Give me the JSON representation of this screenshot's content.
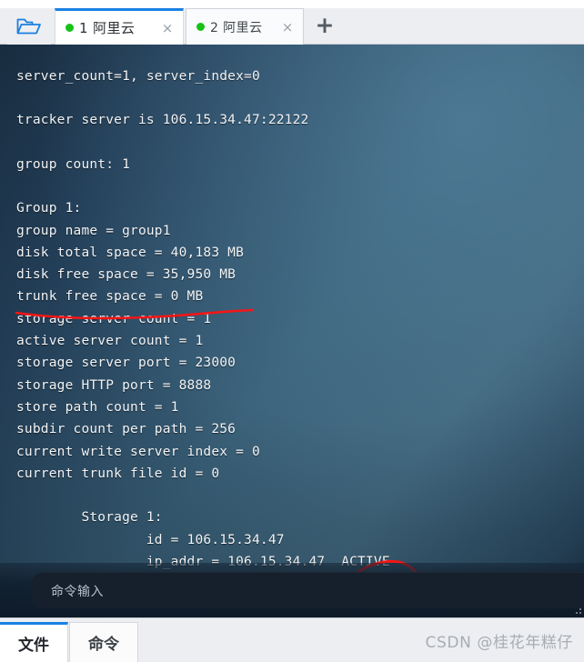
{
  "window": {
    "folder_icon": "open-folder-icon",
    "new_tab_label": "+"
  },
  "tabs": [
    {
      "index": "1",
      "label": "1 阿里云",
      "status_color": "#16c216",
      "close_label": "×",
      "active": true
    },
    {
      "index": "2",
      "label": "2 阿里云",
      "status_color": "#16c216",
      "close_label": "×",
      "active": false
    }
  ],
  "terminal": {
    "background_color": "#3a6179",
    "text_color": "#f2f4f6",
    "output": "server_count=1, server_index=0\n\ntracker server is 106.15.34.47:22122\n\ngroup count: 1\n\nGroup 1:\ngroup name = group1\ndisk total space = 40,183 MB\ndisk free space = 35,950 MB\ntrunk free space = 0 MB\nstorage server count = 1\nactive server count = 1\nstorage server port = 23000\nstorage HTTP port = 8888\nstore path count = 1\nsubdir count per path = 256\ncurrent write server index = 0\ncurrent trunk file id = 0\n\n        Storage 1:\n                id = 106.15.34.47\n                ip_addr = 106.15.34.47  ACTIVE",
    "lines": [
      "server_count=1, server_index=0",
      "",
      "tracker server is 106.15.34.47:22122",
      "",
      "group count: 1",
      "",
      "Group 1:",
      "group name = group1",
      "disk total space = 40,183 MB",
      "disk free space = 35,950 MB",
      "trunk free space = 0 MB",
      "storage server count = 1",
      "active server count = 1",
      "storage server port = 23000",
      "storage HTTP port = 8888",
      "store path count = 1",
      "subdir count per path = 256",
      "current write server index = 0",
      "current trunk file id = 0",
      "",
      "        Storage 1:",
      "                id = 106.15.34.47",
      "                ip_addr = 106.15.34.47  ACTIVE"
    ]
  },
  "annotations": {
    "color": "#f31616",
    "underline_target": "disk free space = 35,950 MB",
    "circle_target": "ACTIVE"
  },
  "command_input": {
    "placeholder": "命令输入",
    "value": ""
  },
  "bottom_tabs": [
    {
      "label": "文件",
      "active": true
    },
    {
      "label": "命令",
      "active": false
    }
  ],
  "watermark": {
    "text": "CSDN @桂花年糕仔"
  }
}
